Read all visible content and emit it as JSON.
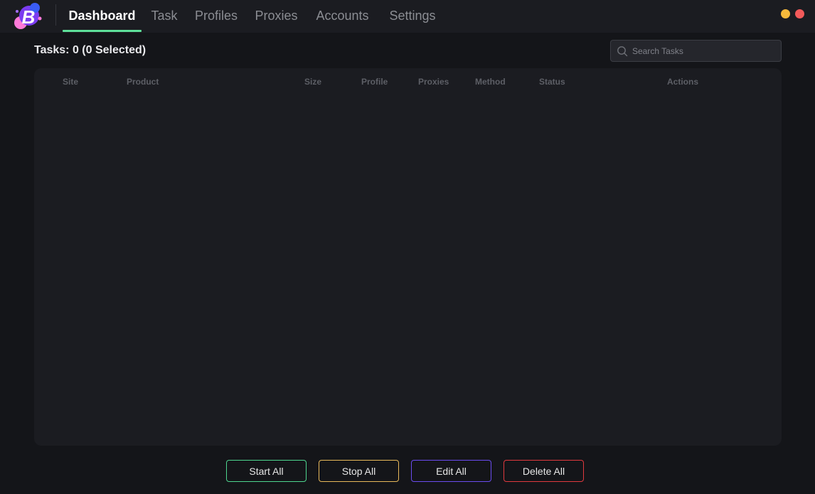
{
  "app": {
    "logo_letter": "B",
    "brand_colors": {
      "pink": "#ff7ad9",
      "purple": "#7b3cf0",
      "blue": "#3a5cf5"
    }
  },
  "nav": {
    "tabs": [
      {
        "label": "Dashboard",
        "active": true
      },
      {
        "label": "Task",
        "active": false
      },
      {
        "label": "Profiles",
        "active": false
      },
      {
        "label": "Proxies",
        "active": false
      },
      {
        "label": "Accounts",
        "active": false
      },
      {
        "label": "Settings",
        "active": false
      }
    ],
    "accent": "#5ee09a"
  },
  "window_controls": {
    "minimize_color": "#f6b93b",
    "close_color": "#f25a5a"
  },
  "tasks": {
    "summary": "Tasks: 0 (0 Selected)",
    "search_placeholder": "Search Tasks",
    "search_value": ""
  },
  "table": {
    "columns": [
      "Site",
      "Product",
      "Size",
      "Profile",
      "Proxies",
      "Method",
      "Status",
      "Actions"
    ],
    "rows": []
  },
  "actions": {
    "start_all": "Start All",
    "stop_all": "Stop All",
    "edit_all": "Edit All",
    "delete_all": "Delete All"
  },
  "icons": {
    "search": "search-icon",
    "logo": "logo-icon"
  }
}
